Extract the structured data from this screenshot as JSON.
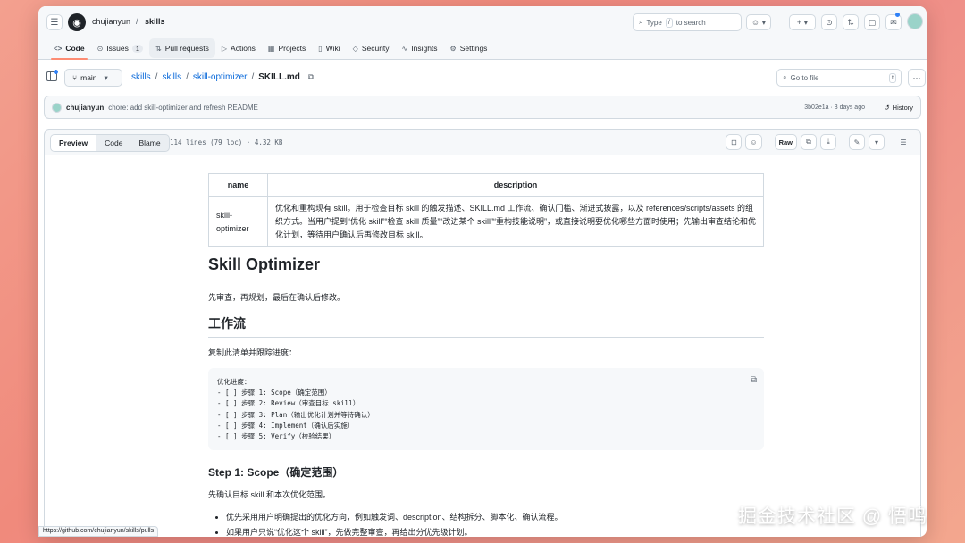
{
  "header": {
    "owner": "chujianyun",
    "separator": "/",
    "repo": "skills",
    "search_label": "Type",
    "search_kbd": "/",
    "search_suffix": "to search"
  },
  "tabs": [
    {
      "label": "Code",
      "icon": "code-icon"
    },
    {
      "label": "Issues",
      "icon": "issue-icon",
      "count": "1"
    },
    {
      "label": "Pull requests",
      "icon": "pull-request-icon"
    },
    {
      "label": "Actions",
      "icon": "play-icon"
    },
    {
      "label": "Projects",
      "icon": "table-icon"
    },
    {
      "label": "Wiki",
      "icon": "book-icon"
    },
    {
      "label": "Security",
      "icon": "shield-icon"
    },
    {
      "label": "Insights",
      "icon": "graph-icon"
    },
    {
      "label": "Settings",
      "icon": "gear-icon"
    }
  ],
  "filenav": {
    "branch": "main",
    "path": [
      "skills",
      "skills",
      "skill-optimizer"
    ],
    "file": "SKILL.md",
    "goto_placeholder": "Go to file",
    "goto_kbd": "t"
  },
  "commit": {
    "author": "chujianyun",
    "message": "chore: add skill-optimizer and refresh README",
    "meta": "3b02e1a · 3 days ago",
    "history": "History"
  },
  "toolbar": {
    "preview": "Preview",
    "code": "Code",
    "blame": "Blame",
    "info": "114 lines (79 loc) · 4.32 KB",
    "raw": "Raw"
  },
  "doc": {
    "table": {
      "headers": [
        "name",
        "description"
      ],
      "name": "skill-optimizer",
      "description": "优化和重构现有 skill。用于检查目标 skill 的触发描述、SKILL.md 工作流、确认门槛、渐进式披露，以及 references/scripts/assets 的组织方式。当用户提到“优化 skill”“检查 skill 质量”“改进某个 skill”“重构技能说明”，或直接说明要优化哪些方面时使用；先输出审查结论和优化计划，等待用户确认后再修改目标 skill。"
    },
    "h1": "Skill Optimizer",
    "intro": "先审查，再规划，最后在确认后修改。",
    "h2": "工作流",
    "copy_hint": "复制此清单并跟踪进度：",
    "code": "优化进度：\n- [ ] 步骤 1: Scope（确定范围）\n- [ ] 步骤 2: Review（审查目标 skill）\n- [ ] 步骤 3: Plan（输出优化计划并等待确认）\n- [ ] 步骤 4: Implement（确认后实施）\n- [ ] 步骤 5: Verify（校验结果）",
    "h3": "Step 1: Scope（确定范围）",
    "step1_text": "先确认目标 skill 和本次优化范围。",
    "bullets": [
      "优先采用用户明确提出的优化方向，例如触发词、description、结构拆分、脚本化、确认流程。",
      "如果用户只说“优化这个 skill”，先做完整审查，再给出分优先级计划。"
    ]
  },
  "status_url": "https://github.com/chujianyun/skills/pulls",
  "watermark": "掘金技术社区 @ 悟鸣"
}
